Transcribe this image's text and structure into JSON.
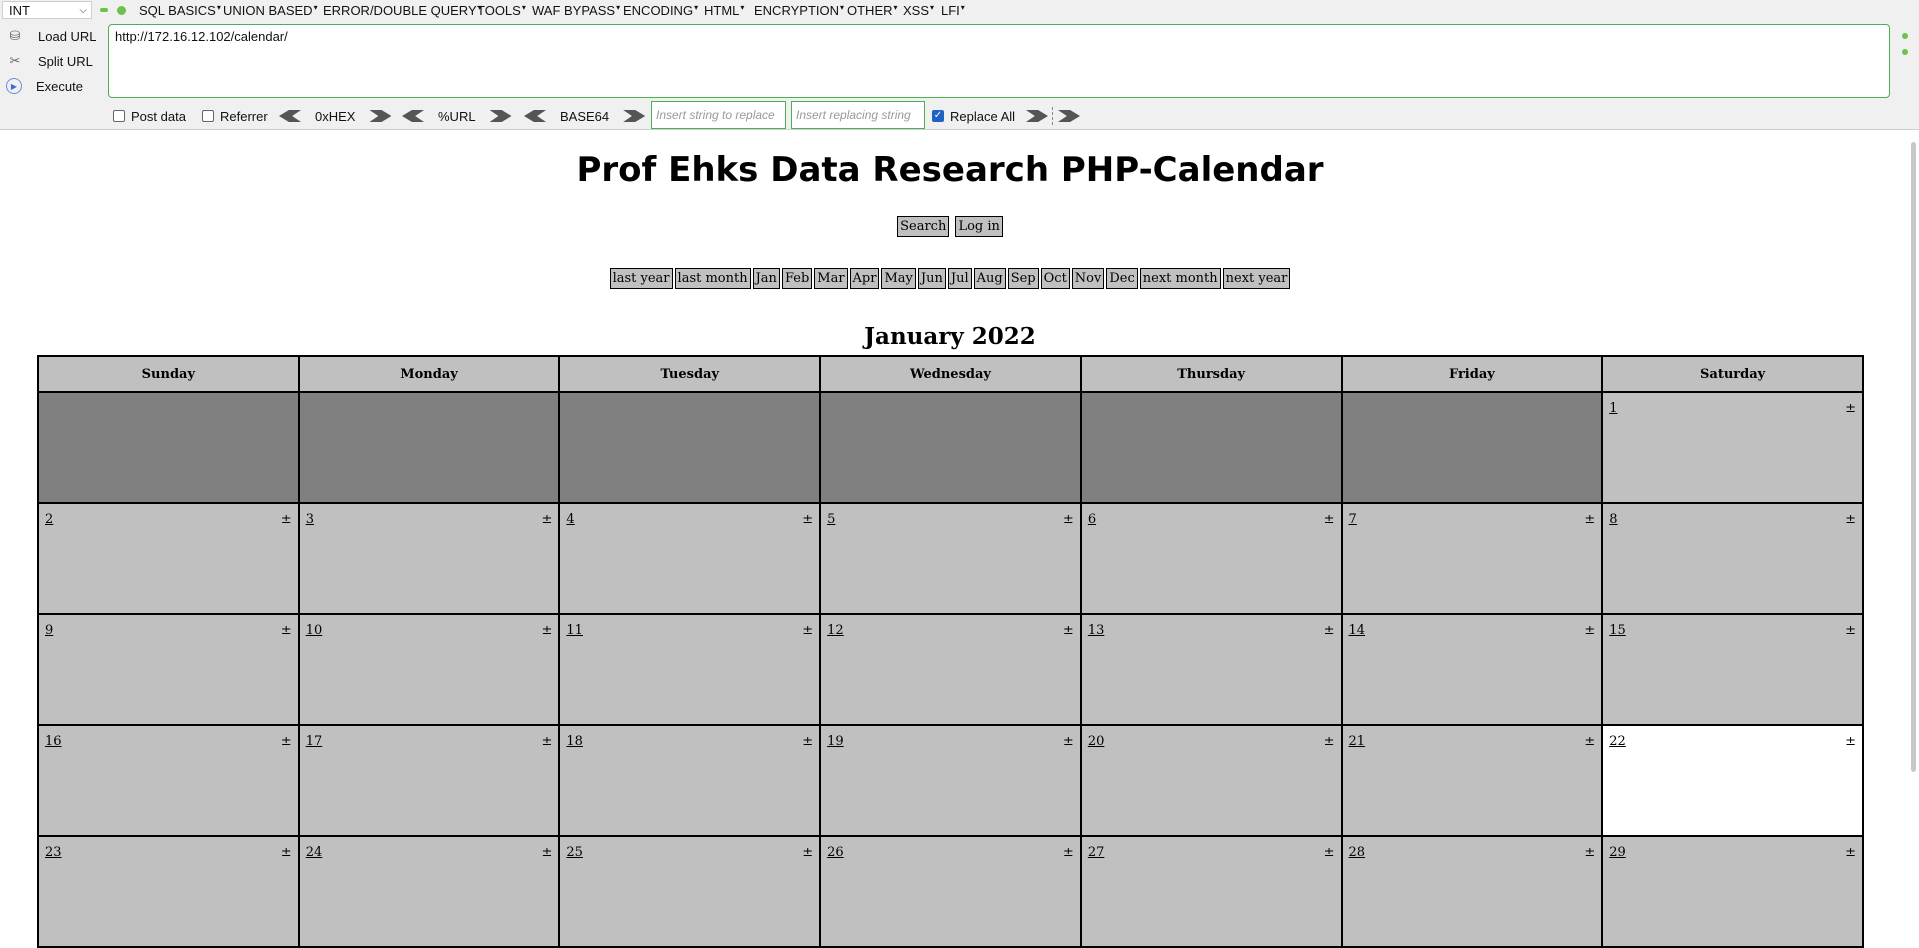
{
  "hackbar": {
    "select": "INT",
    "menus": [
      "SQL BASICS",
      "UNION BASED",
      "ERROR/DOUBLE QUERY",
      "TOOLS",
      "WAF BYPASS",
      "ENCODING",
      "HTML",
      "ENCRYPTION",
      "OTHER",
      "XSS",
      "LFI"
    ],
    "side": {
      "load": "Load URL",
      "split": "Split URL",
      "execute": "Execute"
    },
    "url": "http://172.16.12.102/calendar/",
    "post_data": "Post data",
    "referrer": "Referrer",
    "hex": "0xHEX",
    "url_enc": "%URL",
    "base64": "BASE64",
    "replace_placeholder": "Insert string to replace",
    "replacing_placeholder": "Insert replacing string",
    "replace_all": "Replace All"
  },
  "page": {
    "title": "Prof Ehks Data Research PHP-Calendar",
    "search": "Search",
    "login": "Log in",
    "nav": [
      "last year",
      "last month",
      "Jan",
      "Feb",
      "Mar",
      "Apr",
      "May",
      "Jun",
      "Jul",
      "Aug",
      "Sep",
      "Oct",
      "Nov",
      "Dec",
      "next month",
      "next year"
    ],
    "month_title": "January 2022",
    "weekdays": [
      "Sunday",
      "Monday",
      "Tuesday",
      "Wednesday",
      "Thursday",
      "Friday",
      "Saturday"
    ],
    "weeks": [
      [
        "",
        "",
        "",
        "",
        "",
        "",
        "1"
      ],
      [
        "2",
        "3",
        "4",
        "5",
        "6",
        "7",
        "8"
      ],
      [
        "9",
        "10",
        "11",
        "12",
        "13",
        "14",
        "15"
      ],
      [
        "16",
        "17",
        "18",
        "19",
        "20",
        "21",
        "22"
      ],
      [
        "23",
        "24",
        "25",
        "26",
        "27",
        "28",
        "29"
      ]
    ],
    "add_symbol": "±",
    "today": "22"
  }
}
